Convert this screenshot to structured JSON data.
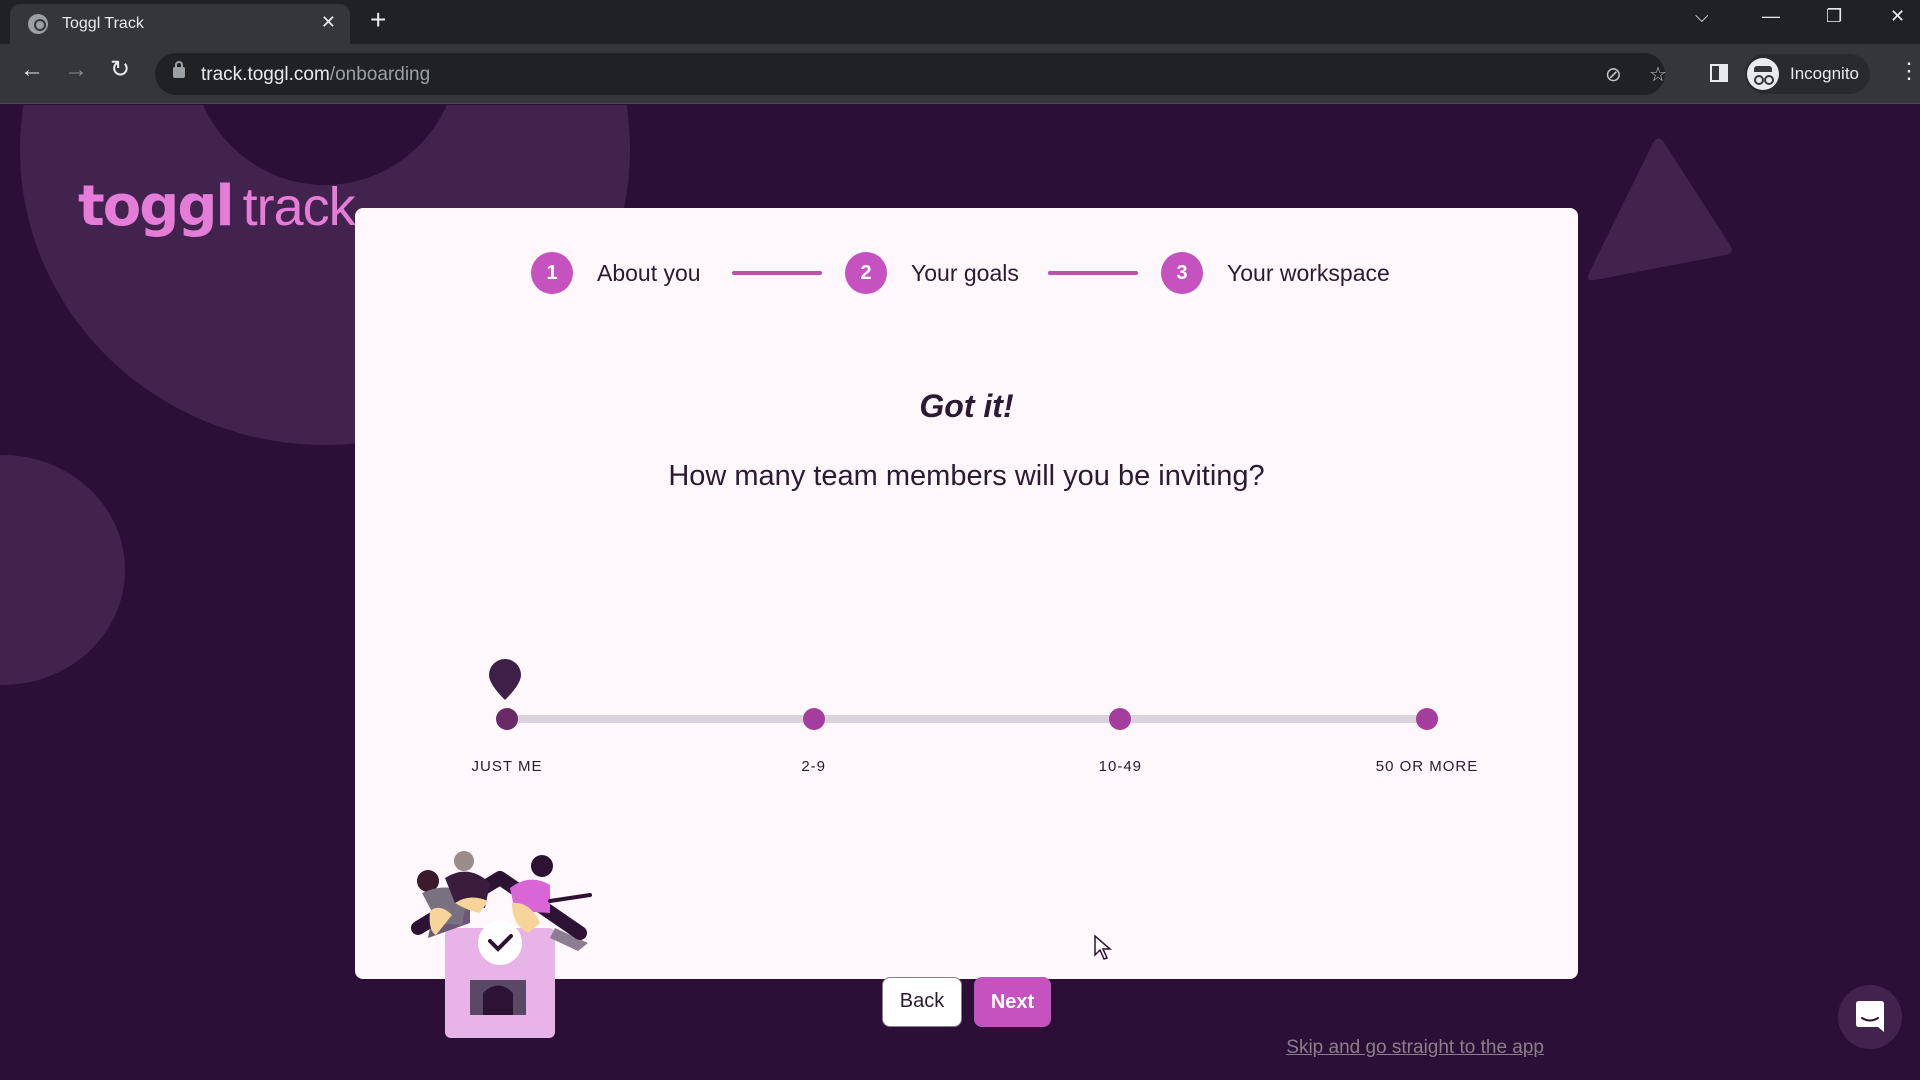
{
  "browser": {
    "tab_title": "Toggl Track",
    "tab_close_icon": "close-icon",
    "new_tab_icon": "plus-icon",
    "url_domain": "track.toggl.com",
    "url_path": "/onboarding",
    "profile_label": "Incognito",
    "window_controls": [
      "chevron-down-icon",
      "minimize-icon",
      "restore-icon",
      "close-icon"
    ]
  },
  "logo": {
    "bold": "toggl",
    "light": "track",
    "color": "#e57cd8"
  },
  "stepper": {
    "steps": [
      {
        "number": "1",
        "label": "About you"
      },
      {
        "number": "2",
        "label": "Your goals"
      },
      {
        "number": "3",
        "label": "Your workspace"
      }
    ],
    "accent": "#c552bf"
  },
  "content": {
    "heading": "Got it!",
    "question": "How many team members will you be inviting?"
  },
  "team_size_slider": {
    "options": [
      "JUST ME",
      "2-9",
      "10-49",
      "50 OR MORE"
    ],
    "selected_index": 0,
    "selected_value": "JUST ME"
  },
  "actions": {
    "back_label": "Back",
    "next_label": "Next",
    "skip_label": "Skip and go straight to the app"
  },
  "colors": {
    "background": "#2c0f37",
    "card": "#fef8fc",
    "accent": "#c552bf",
    "text": "#2c1a33"
  }
}
